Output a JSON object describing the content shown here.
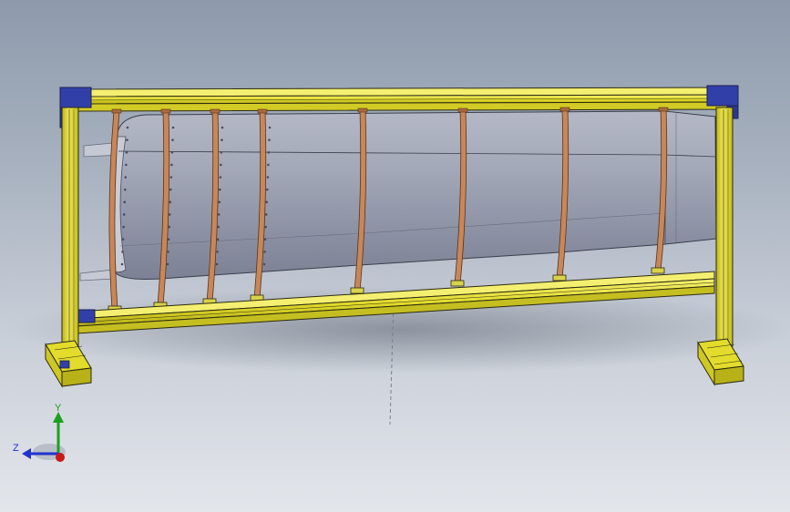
{
  "viewport": {
    "background_top": "#8e9aac",
    "background_bottom": "#e3e6eb"
  },
  "model": {
    "frame_color": "#e8e23a",
    "frame_edge_color": "#2b2a10",
    "corner_block_color": "#3140a8",
    "skin_color": "#9a9fb2",
    "strap_color": "#c8875a",
    "strap_count": 8
  },
  "triad": {
    "x_axis_color": "#c81818",
    "y_axis_color": "#1ea01e",
    "z_axis_color": "#2233cc",
    "y_label": "Y",
    "z_label": "Z"
  }
}
